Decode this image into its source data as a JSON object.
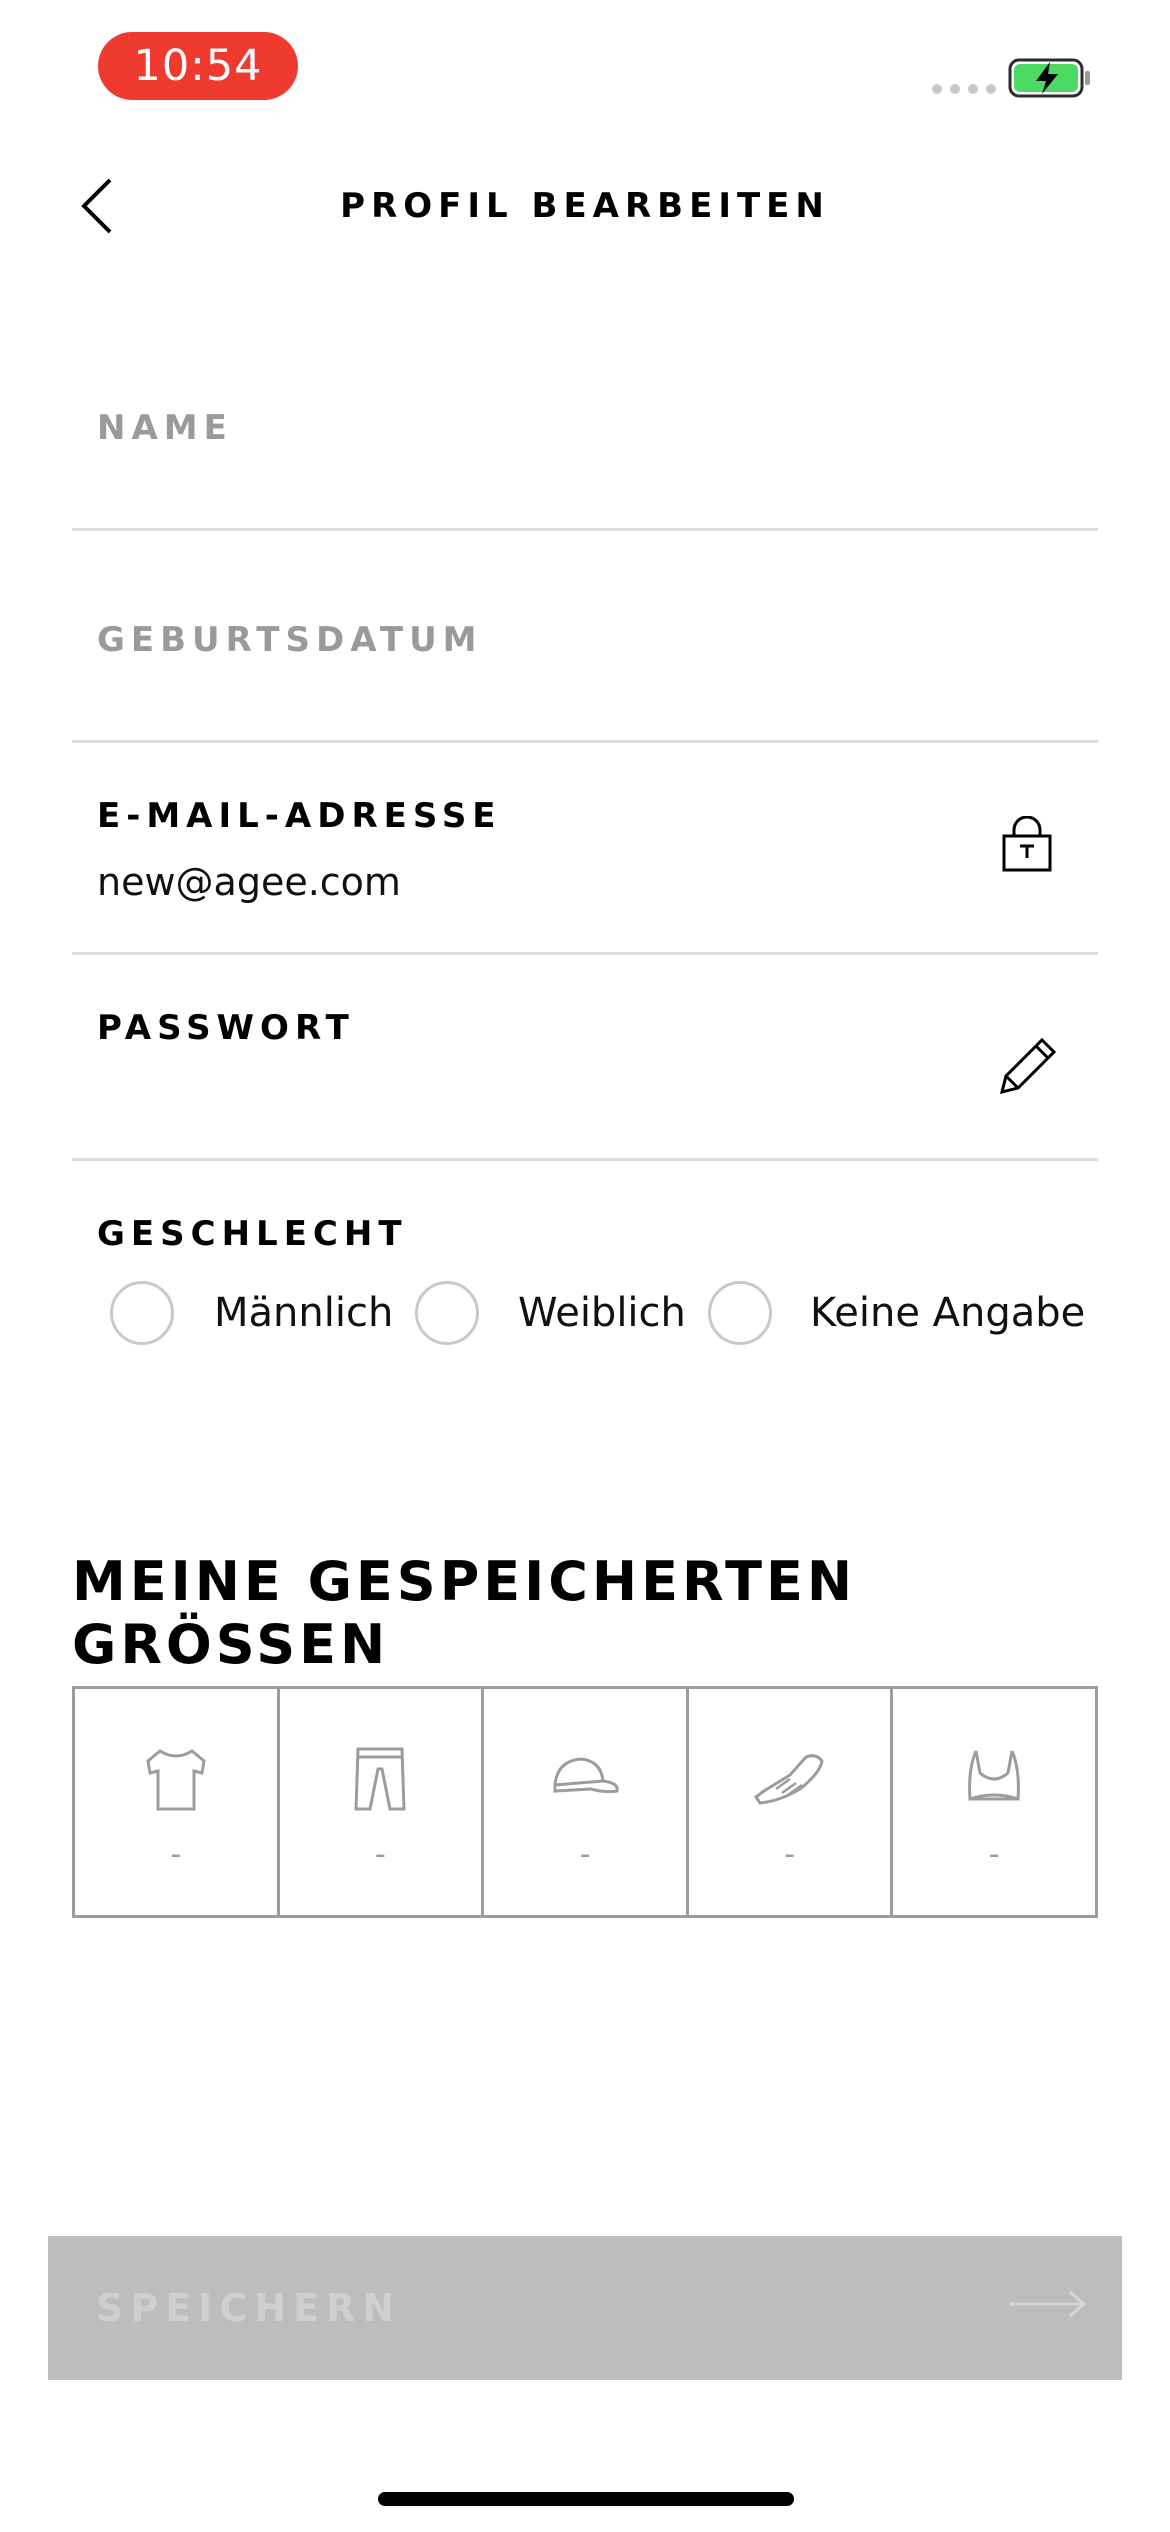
{
  "status_bar": {
    "time": "10:54"
  },
  "header": {
    "title": "PROFIL BEARBEITEN"
  },
  "form": {
    "name_label": "NAME",
    "birthdate_label": "GEBURTSDATUM",
    "email_label": "E-MAIL-ADRESSE",
    "email_value": "new@agee.com",
    "password_label": "PASSWORT",
    "gender_label": "GESCHLECHT",
    "gender_options": [
      "Männlich",
      "Weiblich",
      "Keine Angabe"
    ]
  },
  "sizes": {
    "title": "MEINE GESPEICHERTEN GRÖSSEN",
    "items": [
      {
        "icon": "tshirt-icon",
        "value": "-"
      },
      {
        "icon": "pants-icon",
        "value": "-"
      },
      {
        "icon": "cap-icon",
        "value": "-"
      },
      {
        "icon": "shoe-icon",
        "value": "-"
      },
      {
        "icon": "sports-bra-icon",
        "value": "-"
      }
    ]
  },
  "footer": {
    "save_label": "SPEICHERN"
  },
  "colors": {
    "accent_red": "#ee3a2f",
    "battery_green": "#4cd964",
    "disabled_button": "#bdbdbd"
  }
}
